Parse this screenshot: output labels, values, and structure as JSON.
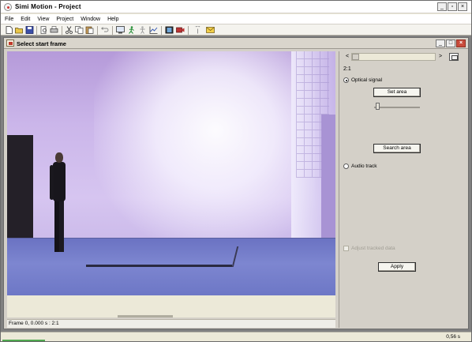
{
  "app": {
    "title": "Simi Motion - Project",
    "window_buttons": [
      "_",
      "▫",
      "×"
    ]
  },
  "menu": [
    "File",
    "Edit",
    "View",
    "Project",
    "Window",
    "Help"
  ],
  "toolbar_icons": [
    "new-file-icon",
    "open-folder-icon",
    "save-icon",
    "print-preview-icon",
    "print-icon",
    "cut-icon",
    "copy-icon",
    "paste-icon",
    "undo-icon",
    "monitor-icon",
    "runner-icon",
    "figure-icon",
    "graph-icon",
    "film-icon",
    "camera-icon",
    "antenna-icon",
    "envelope-icon"
  ],
  "child_window": {
    "title": "Select start frame",
    "buttons": [
      "_",
      "□",
      "×"
    ]
  },
  "video": {
    "status": "Frame 0, 0.000 s : 2:1"
  },
  "side_panel": {
    "nav_left": "<",
    "nav_right": ">",
    "ratio": "2:1",
    "optical_signal": "Optical signal",
    "set_area": "Set area",
    "search_area": "Search area",
    "audio_track": "Audio track",
    "adjust_tracked": "Adjust tracked data",
    "apply": "Apply",
    "optical_selected": true,
    "audio_selected": false
  },
  "status_bar": {
    "speed": "0,56 s"
  }
}
